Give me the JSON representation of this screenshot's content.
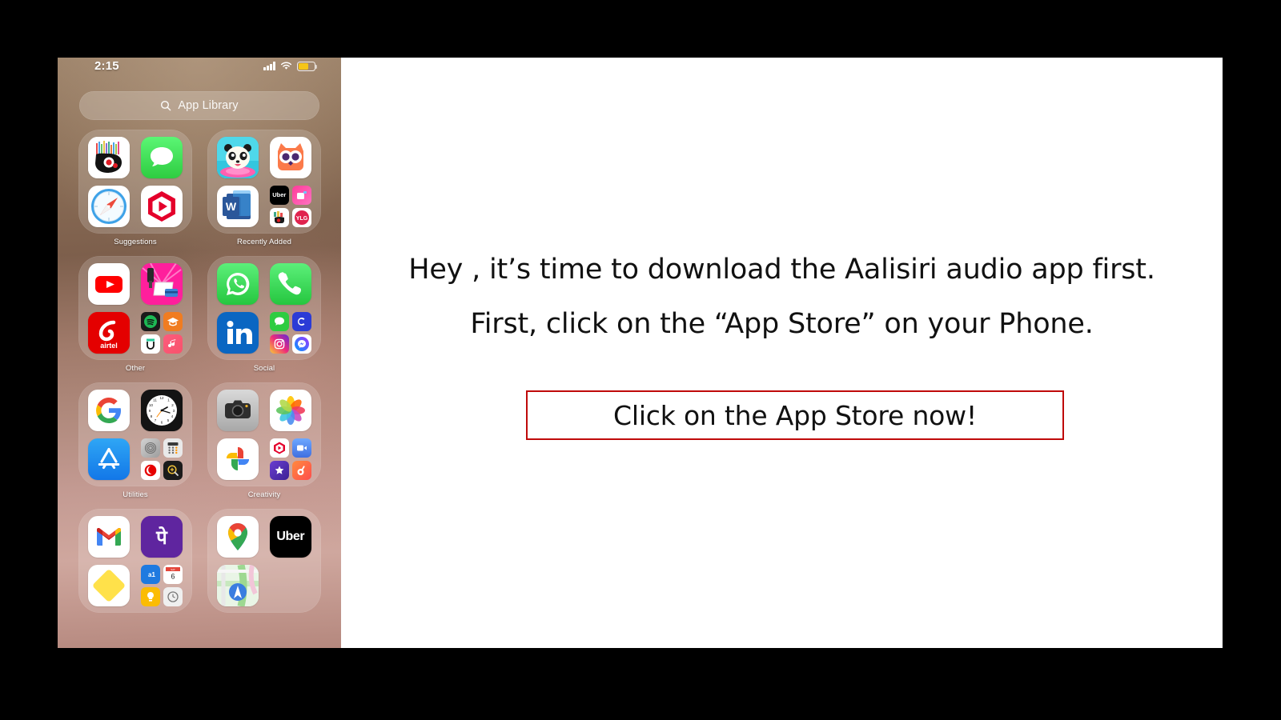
{
  "phone": {
    "status_bar": {
      "time": "2:15",
      "cellular_icon": "signal-bars-icon",
      "wifi_icon": "wifi-icon",
      "battery_icon": "battery-low-power-icon"
    },
    "search": {
      "icon": "search-icon",
      "label": "App Library"
    },
    "folders": [
      {
        "name": "Suggestions",
        "apps": [
          {
            "name": "Pocket Code",
            "kind": "single"
          },
          {
            "name": "Messages",
            "kind": "single"
          },
          {
            "name": "Safari",
            "kind": "single"
          },
          {
            "name": "Shield TV / Play",
            "kind": "single"
          }
        ]
      },
      {
        "name": "Recently Added",
        "apps": [
          {
            "name": "Panda Game",
            "kind": "single"
          },
          {
            "name": "Duolingo Owl",
            "kind": "single"
          },
          {
            "name": "Microsoft Word",
            "kind": "single"
          },
          {
            "name": "More apps",
            "kind": "cluster",
            "children": [
              "Uber",
              "Beauty App",
              "Sticker App",
              "YLG"
            ]
          }
        ]
      },
      {
        "name": "Other",
        "apps": [
          {
            "name": "YouTube",
            "kind": "single"
          },
          {
            "name": "Billing App",
            "kind": "single"
          },
          {
            "name": "Airtel",
            "kind": "single"
          },
          {
            "name": "More apps",
            "kind": "cluster",
            "children": [
              "Spotify",
              "Udemy",
              "Unacademy",
              "Music"
            ]
          }
        ]
      },
      {
        "name": "Social",
        "apps": [
          {
            "name": "WhatsApp",
            "kind": "single"
          },
          {
            "name": "Phone",
            "kind": "single"
          },
          {
            "name": "LinkedIn",
            "kind": "single"
          },
          {
            "name": "More apps",
            "kind": "cluster",
            "children": [
              "Messages",
              "Chingari",
              "Instagram",
              "Messenger"
            ]
          }
        ]
      },
      {
        "name": "Utilities",
        "apps": [
          {
            "name": "Google",
            "kind": "single"
          },
          {
            "name": "Clock",
            "kind": "single"
          },
          {
            "name": "App Store",
            "kind": "single"
          },
          {
            "name": "More apps",
            "kind": "cluster",
            "children": [
              "Settings",
              "Calculator",
              "Vodafone",
              "Magnifier"
            ]
          }
        ]
      },
      {
        "name": "Creativity",
        "apps": [
          {
            "name": "Camera",
            "kind": "single"
          },
          {
            "name": "Photos",
            "kind": "single"
          },
          {
            "name": "Google Photos",
            "kind": "single"
          },
          {
            "name": "More apps",
            "kind": "cluster",
            "children": [
              "Play",
              "FaceTime",
              "iMovie",
              "GarageBand"
            ]
          }
        ]
      },
      {
        "name": "",
        "apps": [
          {
            "name": "Gmail",
            "kind": "single"
          },
          {
            "name": "PhonePe",
            "kind": "single"
          },
          {
            "name": "Notes",
            "kind": "single"
          },
          {
            "name": "More apps",
            "kind": "cluster",
            "children": [
              "Amazon Alexa",
              "Calendar",
              "Keep",
              "Clock"
            ]
          }
        ]
      },
      {
        "name": "",
        "apps": [
          {
            "name": "Google Maps",
            "kind": "single"
          },
          {
            "name": "Uber",
            "kind": "single"
          },
          {
            "name": "Apple Maps",
            "kind": "single"
          },
          {
            "name": "",
            "kind": "empty"
          }
        ]
      }
    ]
  },
  "slide": {
    "line1": "Hey , it’s time to  download the Aalisiri audio app first.",
    "line2": "First, click on the “App Store” on your Phone.",
    "cta_label": "Click on the App Store now!",
    "cta_border_color": "#bf0a0a",
    "background_color": "#ffffff",
    "text_color": "#111111"
  },
  "canvas": {
    "background_color": "#000000"
  }
}
